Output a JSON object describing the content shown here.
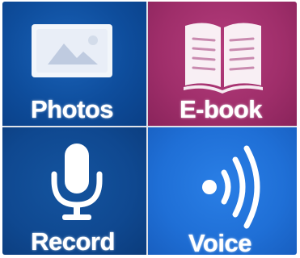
{
  "menu": {
    "tiles": [
      {
        "label": "Photos",
        "icon": "photo-icon",
        "color": "#0e4d9c"
      },
      {
        "label": "E-book",
        "icon": "book-icon",
        "color": "#9f2e6a"
      },
      {
        "label": "Record",
        "icon": "microphone-icon",
        "color": "#0f4890"
      },
      {
        "label": "Voice",
        "icon": "speaker-waves-icon",
        "color": "#1f6fd6"
      }
    ]
  }
}
